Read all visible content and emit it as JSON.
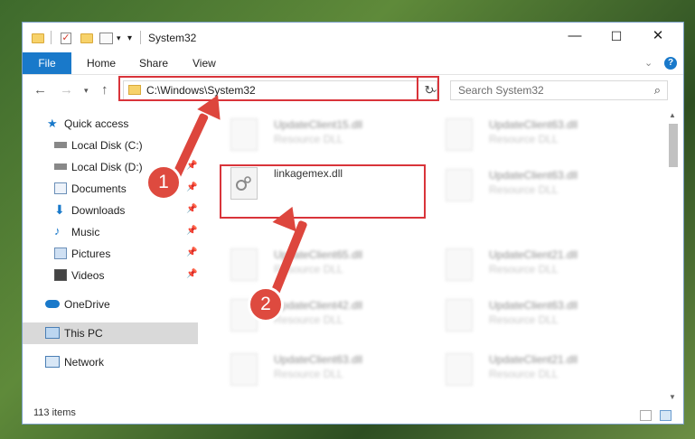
{
  "window": {
    "title": "System32",
    "controls": {
      "minimize": "—",
      "maximize": "☐",
      "close": "✕"
    }
  },
  "ribbon": {
    "tabs": [
      "File",
      "Home",
      "Share",
      "View"
    ],
    "help": "?"
  },
  "navigation": {
    "address": "C:\\Windows\\System32",
    "search_placeholder": "Search System32",
    "refresh": "↻"
  },
  "sidebar": {
    "items": [
      {
        "label": "Quick access",
        "icon": "star-icon"
      },
      {
        "label": "Local Disk (C:)",
        "icon": "drive-icon",
        "pinned": true
      },
      {
        "label": "Local Disk (D:)",
        "icon": "drive-icon",
        "pinned": true
      },
      {
        "label": "Documents",
        "icon": "documents-icon",
        "pinned": true
      },
      {
        "label": "Downloads",
        "icon": "download-icon",
        "pinned": true
      },
      {
        "label": "Music",
        "icon": "music-icon",
        "pinned": true
      },
      {
        "label": "Pictures",
        "icon": "pictures-icon",
        "pinned": true
      },
      {
        "label": "Videos",
        "icon": "videos-icon",
        "pinned": true
      },
      {
        "label": "OneDrive",
        "icon": "cloud-icon"
      },
      {
        "label": "This PC",
        "icon": "computer-icon",
        "selected": true
      },
      {
        "label": "Network",
        "icon": "network-icon"
      }
    ]
  },
  "files": [
    {
      "name": "UpdateClient15.dll",
      "type": "Resource DLL"
    },
    {
      "name": "UpdateClient63.dll",
      "type": "Resource DLL"
    },
    {
      "name": "linkagemex.dll",
      "type": ""
    },
    {
      "name": "UpdateClient63.dll",
      "type": "Resource DLL"
    },
    {
      "name": "UpdateClient65.dll",
      "type": "Resource DLL"
    },
    {
      "name": "UpdateClient21.dll",
      "type": "Resource DLL"
    },
    {
      "name": "UpdateClient42.dll",
      "type": "Resource DLL"
    },
    {
      "name": "UpdateClient63.dll",
      "type": "Resource DLL"
    },
    {
      "name": "UpdateClient63.dll",
      "type": "Resource DLL"
    },
    {
      "name": "UpdateClient21.dll",
      "type": "Resource DLL"
    }
  ],
  "status": {
    "item_count": "113 items"
  },
  "callouts": [
    "1",
    "2"
  ],
  "colors": {
    "accent": "#1979ca",
    "callout": "#dd463d",
    "highlight": "#d9343a"
  }
}
